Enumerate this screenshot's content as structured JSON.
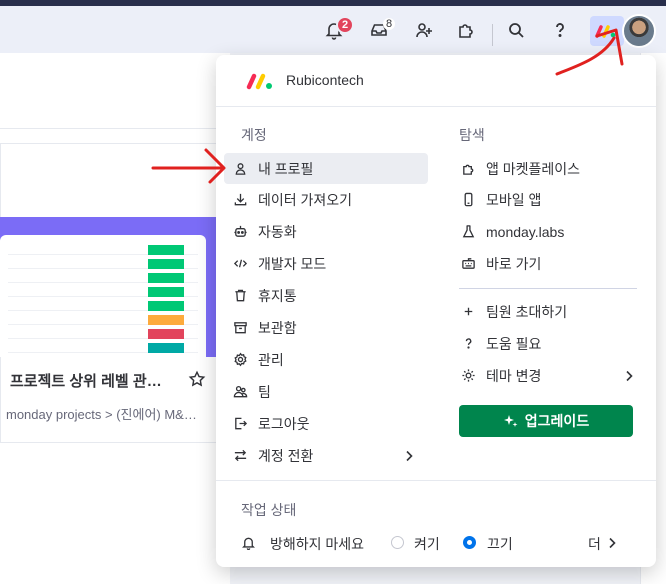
{
  "topbar": {
    "notifications_badge": "2",
    "inbox_count": "8",
    "icons": [
      "bell-icon",
      "inbox-icon",
      "invite-user-icon",
      "apps-puzzle-icon",
      "search-icon",
      "help-icon"
    ]
  },
  "background": {
    "card_title": "프로젝트 상위 레벨 관…",
    "card_subtitle": "monday projects > (진에어) M&…"
  },
  "menu": {
    "workspace_name": "Rubicontech",
    "account": {
      "title": "계정",
      "items": [
        {
          "label": "내 프로필",
          "icon": "user-icon"
        },
        {
          "label": "데이터 가져오기",
          "icon": "download-icon"
        },
        {
          "label": "자동화",
          "icon": "robot-icon"
        },
        {
          "label": "개발자 모드",
          "icon": "code-icon"
        },
        {
          "label": "휴지통",
          "icon": "trash-icon"
        },
        {
          "label": "보관함",
          "icon": "archive-icon"
        },
        {
          "label": "관리",
          "icon": "settings-icon"
        },
        {
          "label": "팀",
          "icon": "team-icon"
        },
        {
          "label": "로그아웃",
          "icon": "logout-icon"
        },
        {
          "label": "계정 전환",
          "icon": "switch-icon"
        }
      ]
    },
    "explore": {
      "title": "탐색",
      "items": [
        {
          "label": "앱 마켓플레이스",
          "icon": "puzzle-icon"
        },
        {
          "label": "모바일 앱",
          "icon": "mobile-icon"
        },
        {
          "label": "monday.labs",
          "icon": "flask-icon"
        },
        {
          "label": "바로 가기",
          "icon": "keyboard-icon"
        }
      ],
      "items2": [
        {
          "label": "팀원 초대하기",
          "icon": "plus-icon"
        },
        {
          "label": "도움 필요",
          "icon": "question-icon"
        },
        {
          "label": "테마 변경",
          "icon": "sun-icon"
        }
      ],
      "upgrade_label": "업그레이드"
    },
    "status": {
      "title": "작업 상태",
      "dnd_label": "방해하지 마세요",
      "on_label": "켜기",
      "off_label": "끄기",
      "more_label": "더"
    }
  },
  "colors": {
    "accent_green": "#00854d",
    "radio_blue": "#0073ea",
    "badge_red": "#e2445c",
    "annotation_red": "#e0211f"
  }
}
